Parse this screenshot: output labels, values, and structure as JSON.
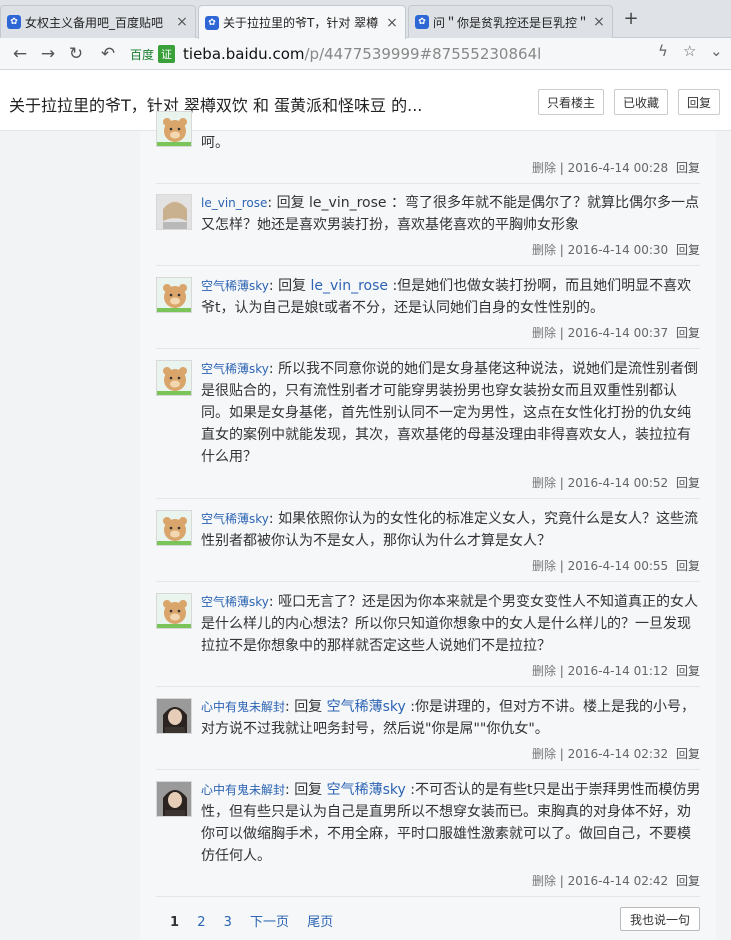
{
  "browser": {
    "tabs": [
      {
        "title": "女权主义备用吧_百度贴吧"
      },
      {
        "title": "关于拉拉里的爷T，针对 翠樽"
      },
      {
        "title": "问＂你是贫乳控还是巨乳控＂"
      }
    ],
    "new_tab": "+",
    "url": {
      "badge_baidu": "百度",
      "badge_zheng": "证",
      "host": "tieba.baidu.com",
      "path": "/p/4477539999#87555230864l"
    }
  },
  "header": {
    "title": "关于拉拉里的爷T，针对 翠樽双饮 和 蛋黄派和怪味豆 的...",
    "buttons": {
      "only_op": "只看楼主",
      "collected": "已收藏",
      "reply": "回复"
    }
  },
  "posts": [
    {
      "user": "",
      "prefix": "",
      "target": "",
      "text": "呵。",
      "meta": "2016-4-14 00:28",
      "avatar": "bear"
    },
    {
      "user": "le_vin_rose",
      "prefix": "回复",
      "target": "le_vin_rose",
      "text": "：弯了很多年就不能是偶尔了？就算比偶尔多一点又怎样？她还是喜欢男装打扮，喜欢基佬喜欢的平胸帅女形象",
      "meta": "2016-4-14 00:30",
      "avatar": "girl1"
    },
    {
      "user": "空气稀薄sky",
      "prefix": "回复",
      "target": "le_vin_rose",
      "text": ":但是她们也做女装打扮啊，而且她们明显不喜欢爷t，认为自己是娘t或者不分，还是认同她们自身的女性性别的。",
      "meta": "2016-4-14 00:37",
      "avatar": "bear"
    },
    {
      "user": "空气稀薄sky",
      "prefix": "",
      "target": "",
      "text": "所以我不同意你说的她们是女身基佬这种说法，说她们是流性别者倒是很贴合的，只有流性别者才可能穿男装扮男也穿女装扮女而且双重性别都认同。如果是女身基佬，首先性别认同不一定为男性，这点在女性化打扮的仇女纯直女的案例中就能发现，其次，喜欢基佬的母基没理由非得喜欢女人，装拉拉有什么用？",
      "meta": "2016-4-14 00:52",
      "avatar": "bear"
    },
    {
      "user": "空气稀薄sky",
      "prefix": "",
      "target": "",
      "text": "如果依照你认为的女性化的标准定义女人，究竟什么是女人？这些流性别者都被你认为不是女人，那你认为什么才算是女人？",
      "meta": "2016-4-14 00:55",
      "avatar": "bear"
    },
    {
      "user": "空气稀薄sky",
      "prefix": "",
      "target": "",
      "text": "哑口无言了？还是因为你本来就是个男变女变性人不知道真正的女人是什么样儿的内心想法？所以你只知道你想象中的女人是什么样儿的？一旦发现拉拉不是你想象中的那样就否定这些人说她们不是拉拉？",
      "meta": "2016-4-14 01:12",
      "avatar": "bear"
    },
    {
      "user": "心中有鬼未解封",
      "prefix": "回复",
      "target": "空气稀薄sky",
      "text": ":你是讲理的，但对方不讲。楼上是我的小号，对方说不过我就让吧务封号，然后说\"你是屌\"\"你仇女\"。",
      "meta": "2016-4-14 02:32",
      "avatar": "girl2"
    },
    {
      "user": "心中有鬼未解封",
      "prefix": "回复",
      "target": "空气稀薄sky",
      "text": ":不可否认的是有些t只是出于崇拜男性而模仿男性，但有些只是认为自己是直男所以不想穿女装而已。束胸真的对身体不好，劝你可以做缩胸手术，不用全麻，平时口服雄性激素就可以了。做回自己，不要模仿任何人。",
      "meta": "2016-4-14 02:42",
      "avatar": "girl2"
    }
  ],
  "meta_labels": {
    "delete": "删除",
    "sep": "|",
    "reply": "回复"
  },
  "pager": {
    "pages": [
      "1",
      "2",
      "3"
    ],
    "next": "下一页",
    "last": "尾页",
    "say": "我也说一句"
  }
}
